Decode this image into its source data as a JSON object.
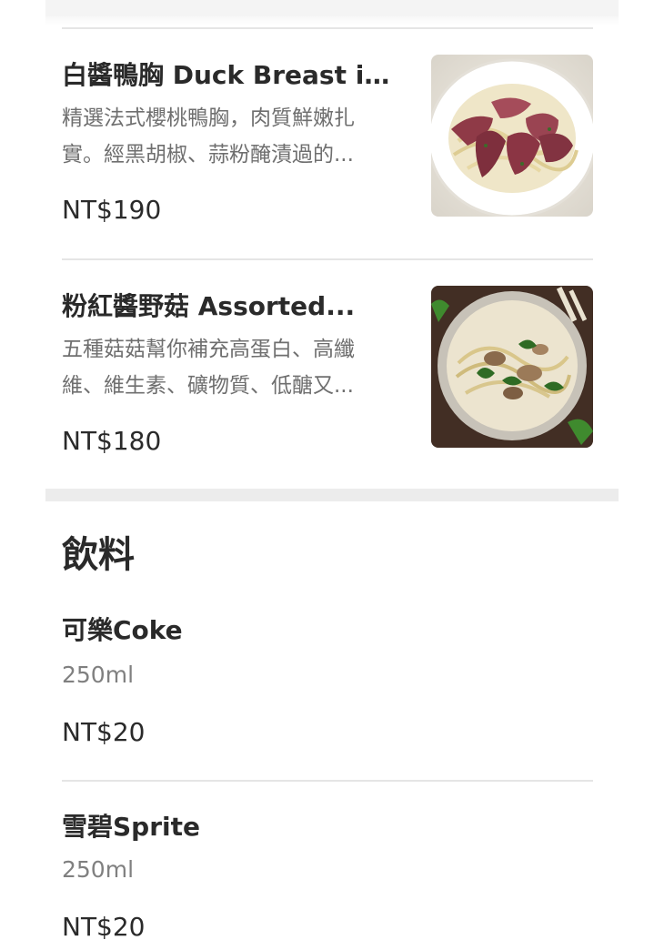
{
  "menu": {
    "dishes": [
      {
        "name": "白醬鴨胸 Duck Breast in...",
        "desc_line1": "精選法式櫻桃鴨胸，肉質鮮嫩扎",
        "desc_line2": "實。經黑胡椒、蒜粉醃漬過的...",
        "price": "NT$190",
        "image_icon": "duck-breast-pasta-photo"
      },
      {
        "name": "粉紅醬野菇 Assorted...",
        "desc_line1": "五種菇菇幫你補充高蛋白、高纖",
        "desc_line2": "維、維生素、礦物質、低醣又...",
        "price": "NT$180",
        "image_icon": "mushroom-pasta-photo"
      }
    ],
    "drinks_section": {
      "title": "飲料",
      "items": [
        {
          "name": "可樂Coke",
          "volume": "250ml",
          "price": "NT$20"
        },
        {
          "name": "雪碧Sprite",
          "volume": "250ml",
          "price": "NT$20"
        }
      ]
    }
  },
  "colors": {
    "divider": "#e5e5e5",
    "section_gap": "#ececec",
    "text_primary": "#2a2a2a",
    "text_secondary": "#6f6f6f"
  }
}
